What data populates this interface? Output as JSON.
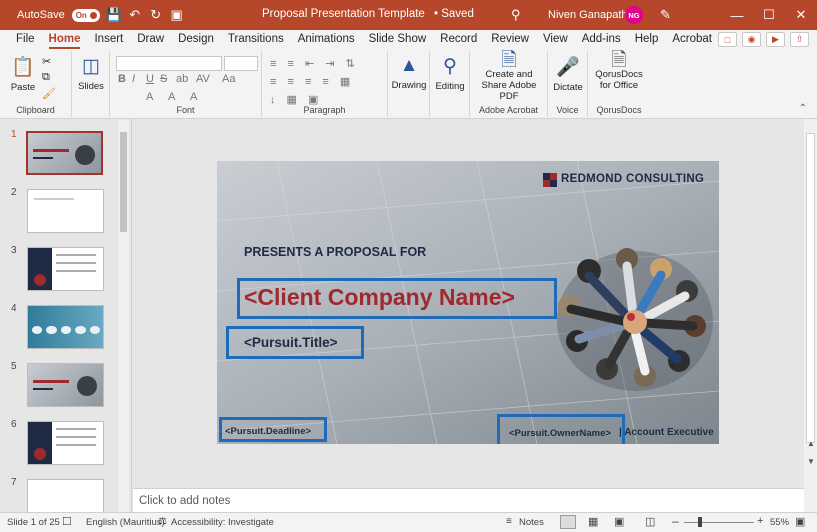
{
  "titlebar": {
    "autosave_label": "AutoSave",
    "autosave_state": "On",
    "doc_title": "Proposal Presentation Template",
    "saved_status": "• Saved",
    "user_name": "Niven Ganapathee",
    "user_initials": "NG"
  },
  "menu": {
    "items": [
      "File",
      "Home",
      "Insert",
      "Draw",
      "Design",
      "Transitions",
      "Animations",
      "Slide Show",
      "Record",
      "Review",
      "View",
      "Add-ins",
      "Help",
      "Acrobat"
    ],
    "active": "Home"
  },
  "ribbon": {
    "paste": "Paste",
    "clipboard": "Clipboard",
    "slides": "Slides",
    "font": "Font",
    "paragraph": "Paragraph",
    "drawing": "Drawing",
    "editing": "Editing",
    "create_share": "Create and Share Adobe PDF",
    "adobe_acrobat": "Adobe Acrobat",
    "dictate": "Dictate",
    "voice": "Voice",
    "qorus_btn": "QorusDocs for Office",
    "qorus_group": "QorusDocs",
    "format_buttons": [
      "B",
      "I",
      "U",
      "S",
      "ab",
      "AV",
      "Aa",
      "A",
      "A",
      "A"
    ]
  },
  "thumbnails": [
    {
      "num": "1",
      "selected": true
    },
    {
      "num": "2",
      "selected": false
    },
    {
      "num": "3",
      "selected": false
    },
    {
      "num": "4",
      "selected": false
    },
    {
      "num": "5",
      "selected": false
    },
    {
      "num": "6",
      "selected": false
    },
    {
      "num": "7",
      "selected": false
    }
  ],
  "slide": {
    "logo": "REDMOND CONSULTING",
    "presents": "PRESENTS A PROPOSAL FOR",
    "client": "<Client Company Name>",
    "pursuit_title": "<Pursuit.Title>",
    "deadline": "<Pursuit.Deadline>",
    "owner": "<Pursuit.OwnerName>",
    "role": "| Account Executive"
  },
  "notes": {
    "placeholder": "Click to add notes"
  },
  "status": {
    "slide_count": "Slide 1 of 25",
    "language": "English (Mauritius)",
    "accessibility": "Accessibility: Investigate",
    "notes": "Notes",
    "zoom": "55%"
  },
  "colors": {
    "accent": "#b7472a",
    "client_red": "#a1282c",
    "highlight_box": "#1e6bb8",
    "navy": "#1f2a44"
  }
}
